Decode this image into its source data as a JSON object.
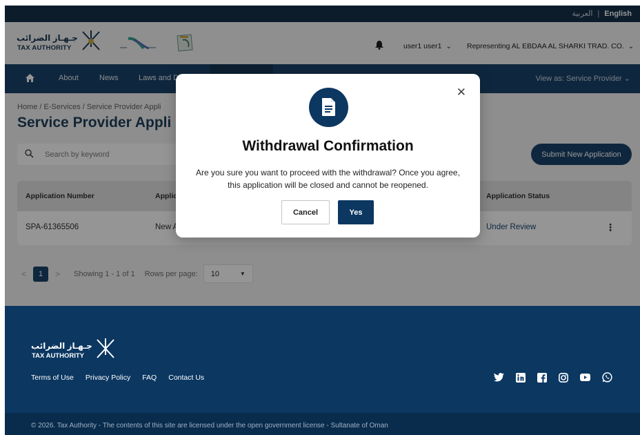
{
  "lang": {
    "arabic": "العربية",
    "separator": "|",
    "english": "English"
  },
  "header": {
    "logo_arabic": "جـهـاز الضرائب",
    "logo_english": "TAX AUTHORITY",
    "user_name": "user1 user1",
    "representing": "Representing AL EBDAA AL SHARKI TRAD. CO."
  },
  "nav": {
    "items": [
      "About",
      "News",
      "Laws and D"
    ],
    "view_as": "View as: Service Provider"
  },
  "content": {
    "breadcrumb": "Home / E-Services / Service Provider Appli",
    "title": "Service Provider Appli",
    "search_placeholder": "Search by keyword",
    "submit_label": "Submit New Application"
  },
  "table": {
    "headers": [
      "Application Number",
      "Applic",
      "Application Status"
    ],
    "rows": [
      {
        "number": "SPA-61365506",
        "type": "New A",
        "status": "Under Review"
      }
    ]
  },
  "pagination": {
    "current_page": "1",
    "showing": "Showing 1 - 1 of 1",
    "rows_label": "Rows per page:",
    "rows_value": "10"
  },
  "modal": {
    "title": "Withdrawal Confirmation",
    "message": "Are you sure you want to proceed with the withdrawal? Once you agree, this application will be closed and cannot be reopened.",
    "cancel_label": "Cancel",
    "yes_label": "Yes",
    "close_glyph": "✕"
  },
  "footer": {
    "logo_arabic": "جـهـاز الضرائب",
    "logo_english": "TAX AUTHORITY",
    "links": [
      "Terms of Use",
      "Privacy Policy",
      "FAQ",
      "Contact Us"
    ],
    "social_icons": [
      "twitter-icon",
      "linkedin-icon",
      "facebook-icon",
      "instagram-icon",
      "youtube-icon",
      "whatsapp-icon"
    ],
    "copyright": "© 2026. Tax Authority - The contents of this site are licensed under the open government license - Sultanate of Oman"
  },
  "colors": {
    "primary": "#0b3761",
    "dark_bar": "#06243f",
    "overlay": "#000000"
  }
}
